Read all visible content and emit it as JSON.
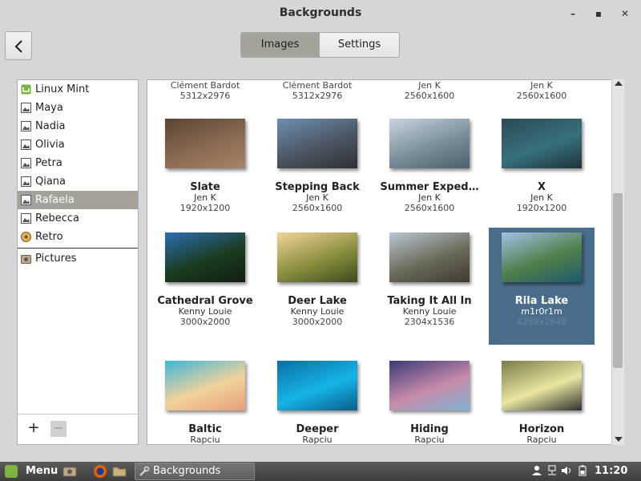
{
  "window": {
    "title": "Backgrounds",
    "minimize_glyph": "–",
    "maximize_glyph": "▪",
    "close_glyph": "✕"
  },
  "toolbar": {
    "tabs": [
      {
        "label": "Images",
        "active": true
      },
      {
        "label": "Settings",
        "active": false
      }
    ]
  },
  "sidebar": {
    "items": [
      {
        "label": "Linux Mint",
        "icon": "mint-icon",
        "selected": false
      },
      {
        "label": "Maya",
        "icon": "image-icon",
        "selected": false
      },
      {
        "label": "Nadia",
        "icon": "image-icon",
        "selected": false
      },
      {
        "label": "Olivia",
        "icon": "image-icon",
        "selected": false
      },
      {
        "label": "Petra",
        "icon": "image-icon",
        "selected": false
      },
      {
        "label": "Qiana",
        "icon": "image-icon",
        "selected": false
      },
      {
        "label": "Rafaela",
        "icon": "image-icon",
        "selected": true
      },
      {
        "label": "Rebecca",
        "icon": "image-icon",
        "selected": false
      },
      {
        "label": "Retro",
        "icon": "retro-icon",
        "selected": false
      }
    ],
    "pictures_label": "Pictures",
    "add_label": "+",
    "remove_label": "−"
  },
  "gallery": {
    "partial_row": [
      {
        "name": "",
        "author": "Clément Bardot",
        "size": "5312x2976"
      },
      {
        "name": "",
        "author": "Clément Bardot",
        "size": "5312x2976"
      },
      {
        "name": "",
        "author": "Jen K",
        "size": "2560x1600"
      },
      {
        "name": "",
        "author": "Jen K",
        "size": "2560x1600"
      }
    ],
    "rows": [
      [
        {
          "name": "Slate",
          "author": "Jen K",
          "size": "1920x1200",
          "colors": [
            "#5a4535",
            "#8a6a52",
            "#a68466"
          ]
        },
        {
          "name": "Stepping Back",
          "author": "Jen K",
          "size": "2560x1600",
          "colors": [
            "#6e8fb3",
            "#4b5560",
            "#2e3035"
          ]
        },
        {
          "name": "Summer Exped…",
          "author": "Jen K",
          "size": "2560x1600",
          "colors": [
            "#c9d5dd",
            "#7a8e9a",
            "#4c5f6a"
          ]
        },
        {
          "name": "X",
          "author": "Jen K",
          "size": "1920x1200",
          "colors": [
            "#2a4b55",
            "#37707c",
            "#1f3338"
          ]
        }
      ],
      [
        {
          "name": "Cathedral Grove",
          "author": "Kenny Louie",
          "size": "3000x2000",
          "colors": [
            "#2b6fb4",
            "#1c3b1e",
            "#0f1f12"
          ]
        },
        {
          "name": "Deer Lake",
          "author": "Kenny Louie",
          "size": "3000x2000",
          "colors": [
            "#f3d49a",
            "#8a8f3e",
            "#3b4a1f"
          ]
        },
        {
          "name": "Taking It All In",
          "author": "Kenny Louie",
          "size": "2304x1536",
          "colors": [
            "#b9c8d4",
            "#6a6a58",
            "#3e3a30"
          ]
        },
        {
          "name": "Rila Lake",
          "author": "m1r0r1m",
          "size": "4288x2848",
          "colors": [
            "#9fc3e6",
            "#4f7f4a",
            "#1e5a6e"
          ],
          "selected": true
        }
      ],
      [
        {
          "name": "Baltic",
          "author": "Rapciu",
          "size": "",
          "colors": [
            "#3fb6d8",
            "#f2d29a",
            "#e79d7d"
          ]
        },
        {
          "name": "Deeper",
          "author": "Rapciu",
          "size": "",
          "colors": [
            "#0a6fa3",
            "#16b4e6",
            "#0a5d8a"
          ]
        },
        {
          "name": "Hiding",
          "author": "Rapciu",
          "size": "",
          "colors": [
            "#3a3a7a",
            "#c78aa8",
            "#7fb2d2"
          ]
        },
        {
          "name": "Horizon",
          "author": "Rapciu",
          "size": "",
          "colors": [
            "#7a7a4a",
            "#e9e6a0",
            "#2f3030"
          ]
        }
      ]
    ]
  },
  "taskbar": {
    "menu_label": "Menu",
    "task_label": "Backgrounds",
    "clock": "11:20"
  }
}
